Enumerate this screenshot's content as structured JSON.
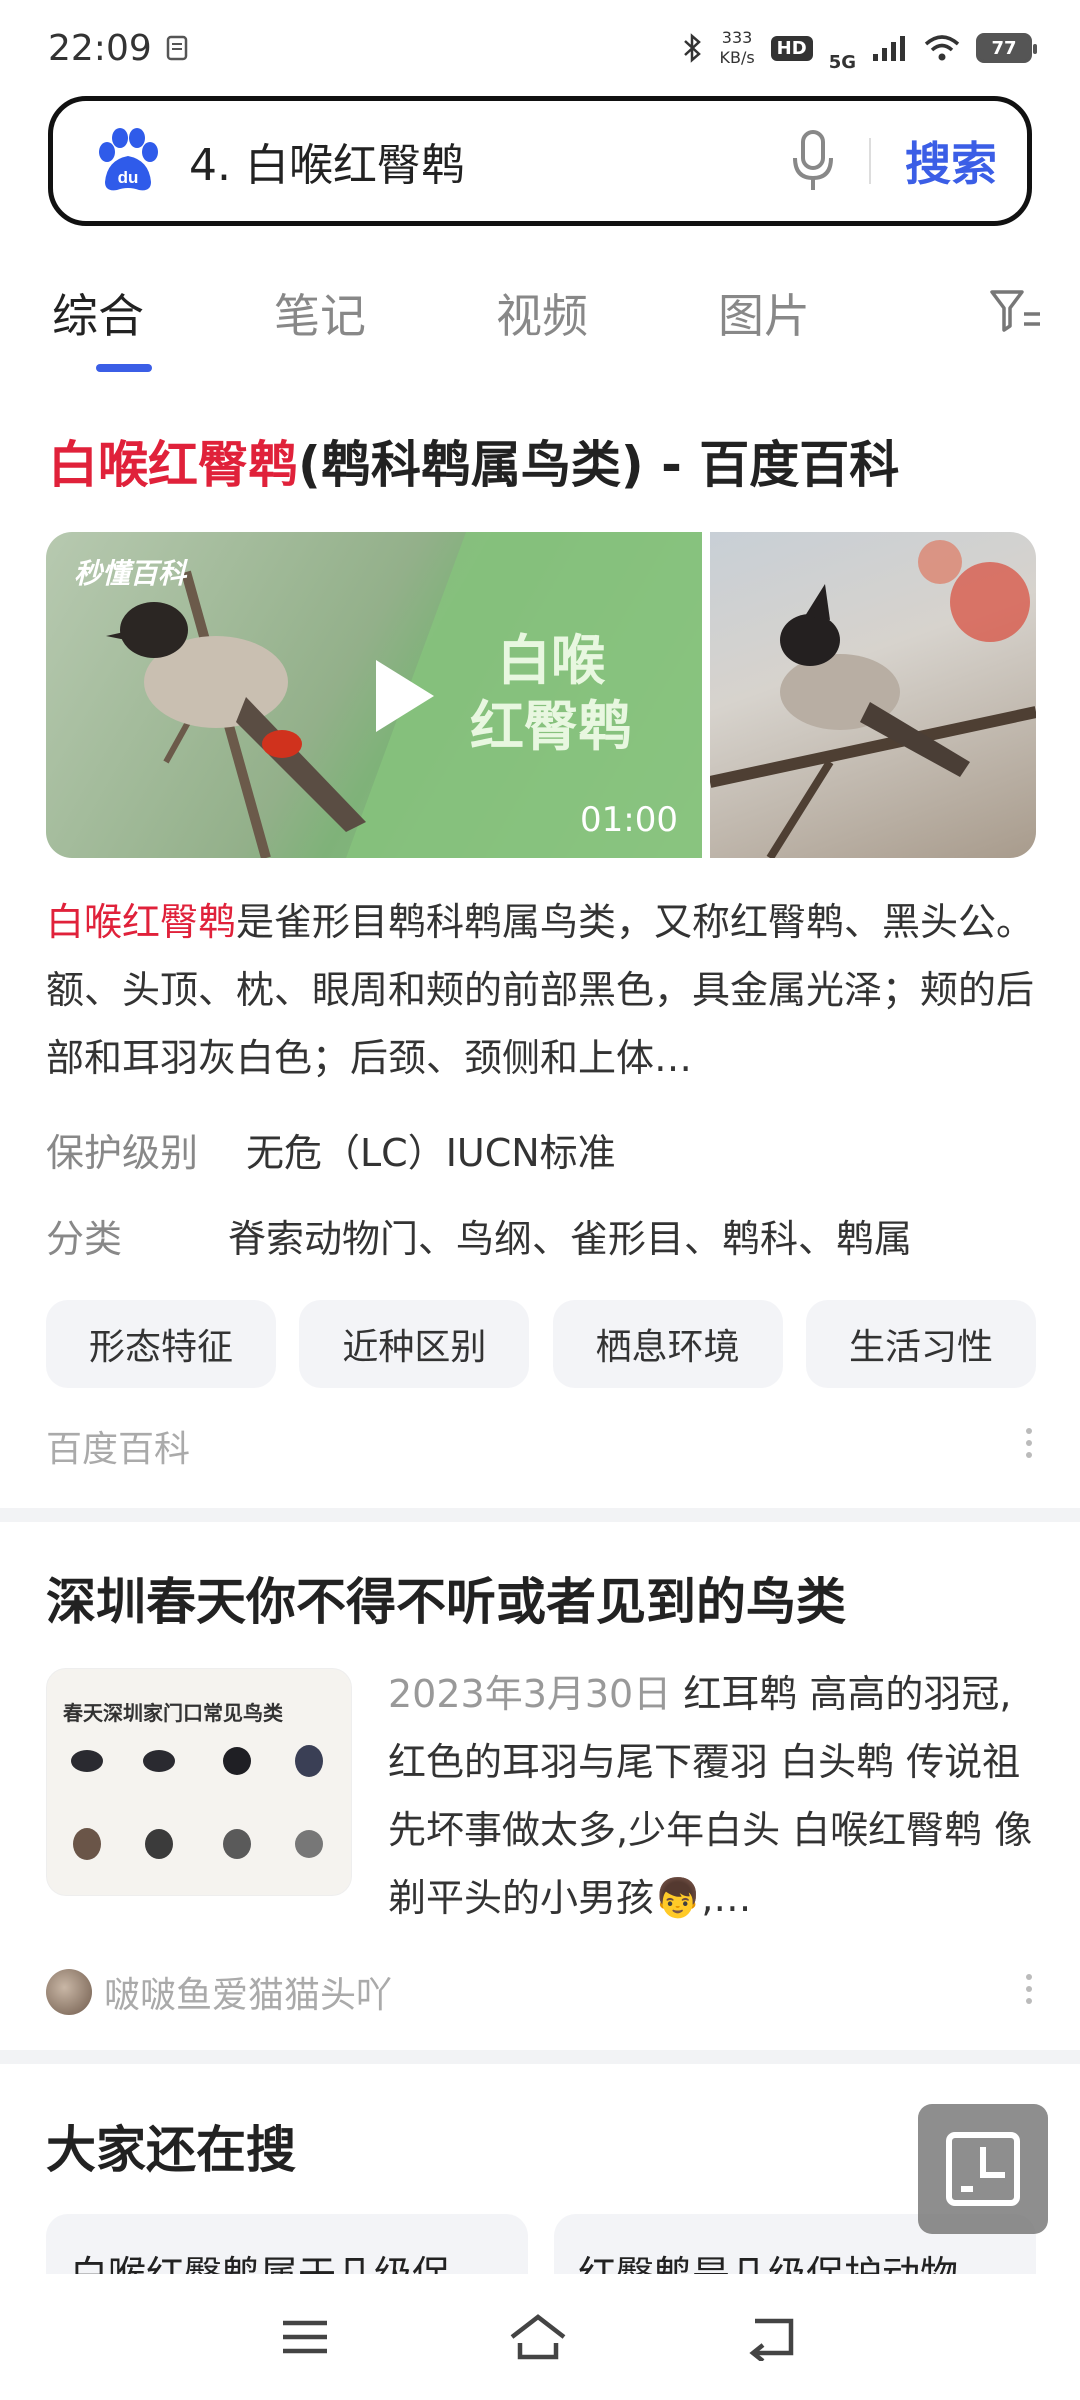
{
  "status_bar": {
    "time": "22:09",
    "net_speed_value": "333",
    "net_speed_unit": "KB/s",
    "hd_badge": "HD",
    "network": "5G",
    "battery": "77"
  },
  "search": {
    "query": "4. 白喉红臀鹎",
    "button_label": "搜索"
  },
  "tabs": [
    {
      "label": "综合",
      "active": true
    },
    {
      "label": "笔记",
      "active": false
    },
    {
      "label": "视频",
      "active": false
    },
    {
      "label": "图片",
      "active": false
    }
  ],
  "result1": {
    "title_highlight": "白喉红臀鹎",
    "title_rest": "(鹎科鹎属鸟类) - 百度百科",
    "video_brand": "秒懂百科",
    "video_overlay_line1": "白喉",
    "video_overlay_line2": "红臀鹎",
    "video_duration": "01:00",
    "desc_highlight": "白喉红臀鹎",
    "desc_rest": "是雀形目鹎科鹎属鸟类，又称红臀鹎、黑头公。额、头顶、枕、眼周和颊的前部黑色，具金属光泽；颊的后部和耳羽灰白色；后颈、颈侧和上体…",
    "protection_label": "保护级别",
    "protection_value": "无危（LC）IUCN标准",
    "class_label": "分类",
    "class_value": "脊索动物门、鸟纲、雀形目、鹎科、鹎属",
    "chips": [
      "形态特征",
      "近种区别",
      "栖息环境",
      "生活习性"
    ],
    "source": "百度百科"
  },
  "result2": {
    "title": "深圳春天你不得不听或者见到的鸟类",
    "thumb_title": "春天深圳家门口常见鸟类",
    "date": "2023年3月30日",
    "text": "红耳鹎 高高的羽冠,红色的耳羽与尾下覆羽 白头鹎 传说祖先坏事做太多,少年白头 白喉红臀鹎 像剃平头的小男孩👦,…",
    "author": "啵啵鱼爱猫猫头吖"
  },
  "also_search": {
    "title": "大家还在搜",
    "items": [
      "白喉红臀鹎属于几级保护动物",
      "红臀鹎是几级保护动物"
    ]
  },
  "colors": {
    "accent": "#3b5ee6",
    "highlight": "#e0213a"
  },
  "icons": [
    "baidu-paw-icon",
    "mic-icon",
    "filter-icon",
    "play-icon",
    "more-dots-icon",
    "floating-window-icon",
    "menu-icon",
    "home-icon",
    "back-icon"
  ]
}
